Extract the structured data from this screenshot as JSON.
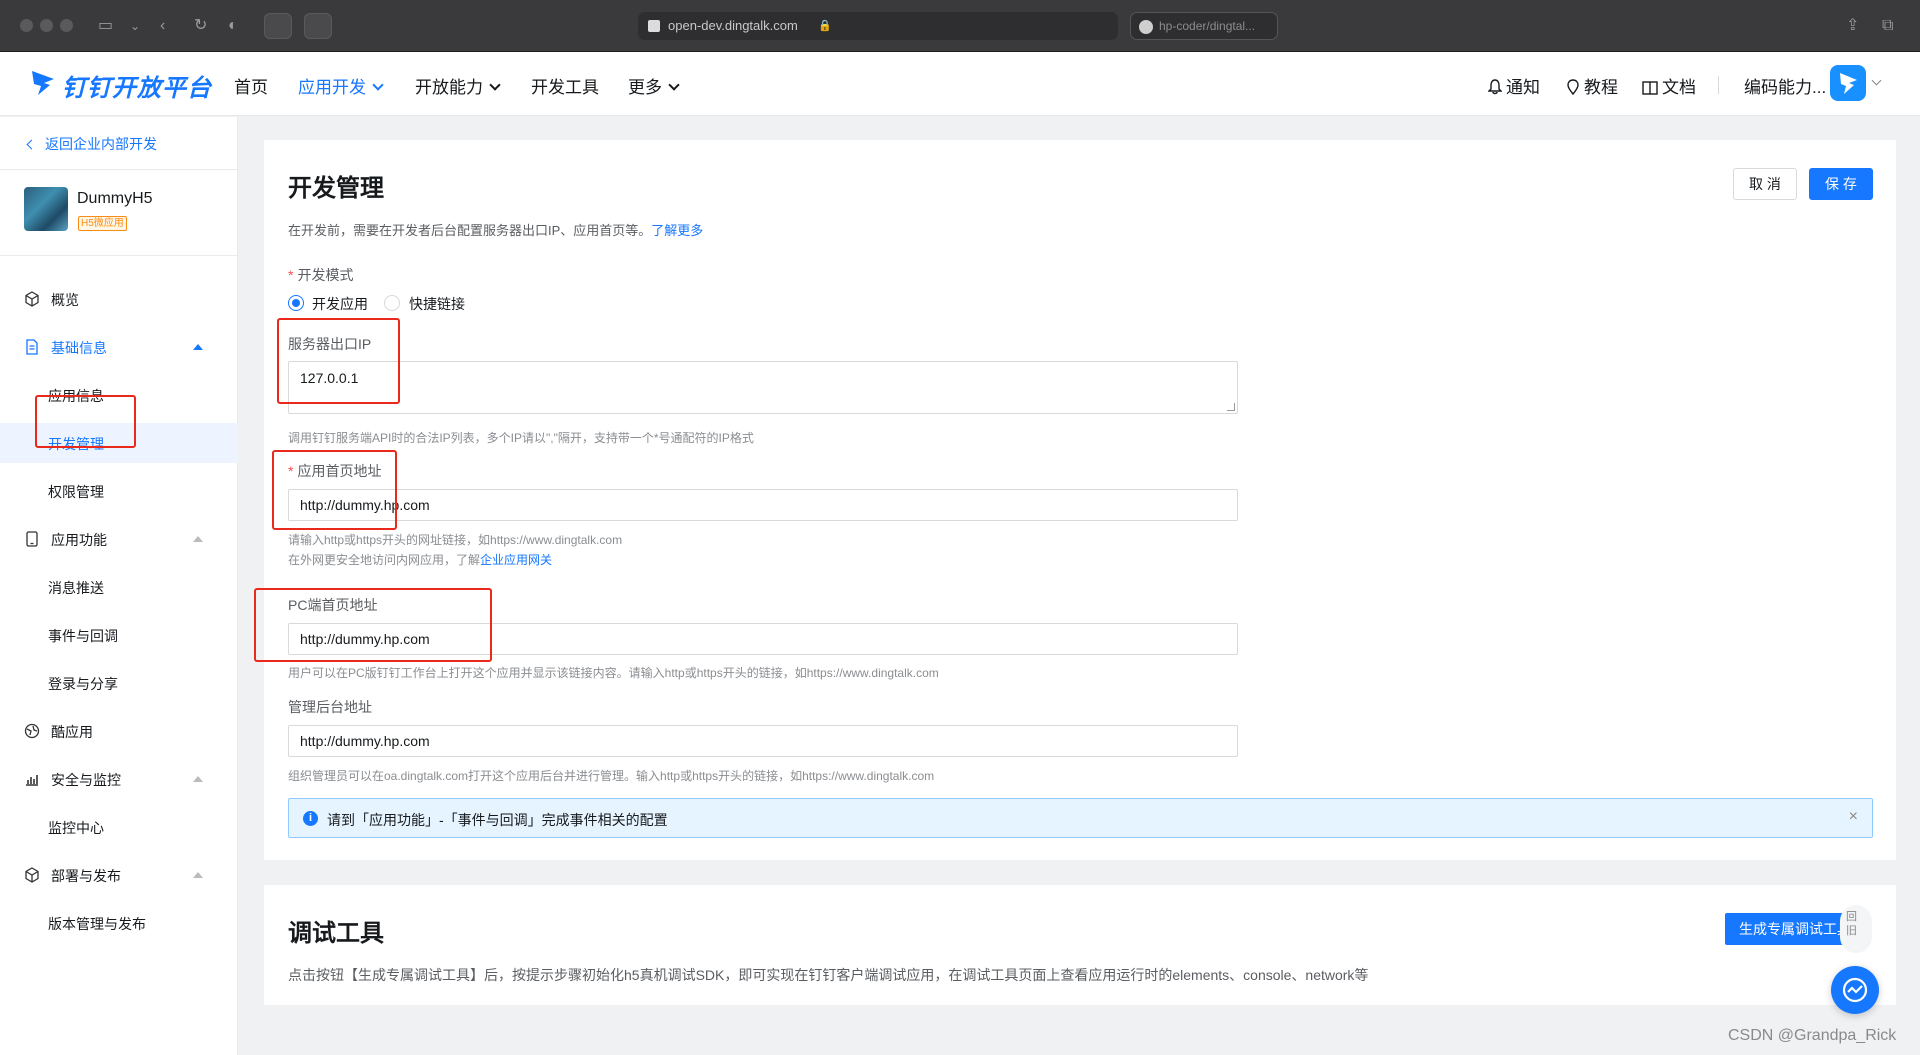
{
  "browser": {
    "url": "open-dev.dingtalk.com",
    "second_tab": "hp-coder/dingtal..."
  },
  "topnav": {
    "logo_text": "钉钉开放平台",
    "items": [
      "首页",
      "应用开发",
      "开放能力",
      "开发工具",
      "更多"
    ],
    "active_item": "应用开发",
    "right_items": [
      "通知",
      "教程",
      "文档"
    ],
    "user_label": "编码能力..."
  },
  "sidebar": {
    "back_link": "返回企业内部开发",
    "app_name": "DummyH5",
    "app_badge": "H5微应用",
    "menu": [
      {
        "label": "概览",
        "icon": "cube-icon"
      },
      {
        "label": "基础信息",
        "icon": "document-icon",
        "expanded": true
      },
      {
        "label": "应用信息"
      },
      {
        "label": "开发管理",
        "selected": true
      },
      {
        "label": "权限管理"
      },
      {
        "label": "应用功能",
        "icon": "phone-icon",
        "expanded": true
      },
      {
        "label": "消息推送"
      },
      {
        "label": "事件与回调"
      },
      {
        "label": "登录与分享"
      },
      {
        "label": "酷应用",
        "icon": "globe-icon"
      },
      {
        "label": "安全与监控",
        "icon": "bar-chart-icon",
        "expanded": true
      },
      {
        "label": "监控中心"
      },
      {
        "label": "部署与发布",
        "icon": "box-icon",
        "expanded": true
      },
      {
        "label": "版本管理与发布"
      }
    ]
  },
  "dev": {
    "title": "开发管理",
    "desc": "在开发前，需要在开发者后台配置服务器出口IP、应用首页等。",
    "learn_more": "了解更多",
    "cancel": "取 消",
    "save": "保 存",
    "mode_label": "开发模式",
    "mode_options": [
      "开发应用",
      "快捷链接"
    ],
    "mode_selected": "开发应用",
    "ip_label": "服务器出口IP",
    "ip_value": "127.0.0.1",
    "ip_hint": "调用钉钉服务端API时的合法IP列表，多个IP请以\",\"隔开，支持带一个*号通配符的IP格式",
    "home_label": "应用首页地址",
    "home_value": "http://dummy.hp.com",
    "home_hint1": "请输入http或https开头的网址链接，如https://www.dingtalk.com",
    "home_hint2": "在外网更安全地访问内网应用，了解",
    "home_hint2_link": "企业应用网关",
    "pc_label": "PC端首页地址",
    "pc_value": "http://dummy.hp.com",
    "pc_hint": "用户可以在PC版钉钉工作台上打开这个应用并显示该链接内容。请输入http或https开头的链接，如https://www.dingtalk.com",
    "admin_label": "管理后台地址",
    "admin_value": "http://dummy.hp.com",
    "admin_hint": "组织管理员可以在oa.dingtalk.com打开这个应用后台并进行管理。输入http或https开头的链接，如https://www.dingtalk.com",
    "alert": "请到「应用功能」-「事件与回调」完成事件相关的配置"
  },
  "debug": {
    "title": "调试工具",
    "desc": "点击按钮【生成专属调试工具】后，按提示步骤初始化h5真机调试SDK，即可实现在钉钉客户端调试应用，在调试工具页面上查看应用运行时的elements、console、network等",
    "button": "生成专属调试工具"
  },
  "float_text": "回旧",
  "watermark": "CSDN @Grandpa_Rick",
  "colors": {
    "accent": "#1677ff",
    "highlight_box": "#e8291c"
  }
}
